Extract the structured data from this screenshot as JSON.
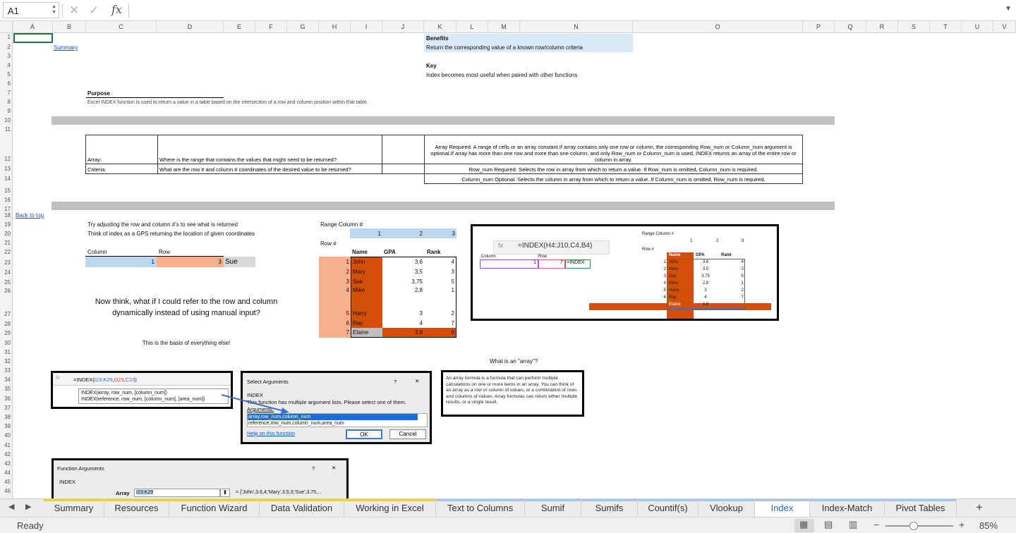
{
  "formula_bar": {
    "name_box": "A1",
    "fx": "fx"
  },
  "columns": [
    "A",
    "B",
    "C",
    "D",
    "E",
    "F",
    "G",
    "H",
    "I",
    "J",
    "K",
    "L",
    "M",
    "N",
    "O",
    "P",
    "Q",
    "R",
    "S",
    "T",
    "U",
    "V"
  ],
  "rows": [
    "1",
    "2",
    "3",
    "4",
    "5",
    "6",
    "7",
    "8",
    "9",
    "10",
    "11",
    "12",
    "13",
    "14",
    "15",
    "16",
    "17",
    "18",
    "19",
    "20",
    "21",
    "22",
    "23",
    "24",
    "25",
    "26",
    "27",
    "28",
    "29",
    "30",
    "31",
    "32",
    "33",
    "34",
    "35",
    "36",
    "37",
    "38",
    "39",
    "40",
    "41",
    "42",
    "43",
    "44",
    "45",
    "46"
  ],
  "sheet": {
    "summary_link": "Summary",
    "back_to_top": "Back to top",
    "benefits_label": "Benefits",
    "benefits_text": "Return the corresponding value of a known row/column criteria",
    "key_label": "Key",
    "key_text": "Index becomes most useful when paired with other functions",
    "purpose_label": "Purpose",
    "purpose_text": "Excel INDEX function is used to return a value in a table based on the intersection of a row and column position within that table.",
    "array_label": "Array:",
    "array_question": "Where is the range that contains the values that might need to be returned?",
    "criteria_label": "Criteria:",
    "criteria_question": "What are the row # and column # coordinates of the desired value to be returned?",
    "array_desc": "Array    Required. A range of cells or an array constant.If array contains only one row or column, the corresponding Row_num or Column_num argument is optional.If array has more than one row and more than one column, and only Row_num or Column_num is used, INDEX returns an array of the entire row or column in array.",
    "rownum_desc": "Row_num    Required. Selects the row in array from which to return a value. If Row_num is omitted, Column_num is required.",
    "colnum_desc": "Column_num    Optional. Selects the column in array from which to return a value. If Column_num is omitted, Row_num is required.",
    "try_text": "Try adjusting the row and column #'s to see what is returned",
    "gps_text": "Think of index as a GPS returning the location of given coordinates",
    "column_label": "Column",
    "row_label": "Row",
    "column_value": "1",
    "row_value": "3",
    "result_value": "Sue",
    "think_text_1": "Now think, what if I could refer to the row and column",
    "think_text_2": "dynamically instead of using manual input?",
    "basis_text": "This is the basis of everything else!",
    "range_column_label": "Range Column #",
    "row_num_label": "Row #",
    "range_cols": [
      "1",
      "2",
      "3"
    ],
    "headers": [
      "Name",
      "GPA",
      "Rank"
    ],
    "table_rows": [
      {
        "n": "1",
        "name": "John",
        "gpa": "3,6",
        "rank": "4"
      },
      {
        "n": "2",
        "name": "Mary",
        "gpa": "3,5",
        "rank": "3"
      },
      {
        "n": "3",
        "name": "Sue",
        "gpa": "3,75",
        "rank": "5"
      },
      {
        "n": "4",
        "name": "Mike",
        "gpa": "2,8",
        "rank": "1"
      },
      {
        "n": "5",
        "name": "Harry",
        "gpa": "3",
        "rank": "2"
      },
      {
        "n": "6",
        "name": "Ray",
        "gpa": "4",
        "rank": "7"
      },
      {
        "n": "7",
        "name": "Elaine",
        "gpa": "3,9",
        "rank": "6"
      }
    ],
    "array_question_title": "What is an \"array\"?",
    "array_explain": "An array formula is a formula that can perform multiple calculations on one or more items in an array. You can think of an array as a row or column of values, or a combination of rows and columns of values. Array formulas can return either multiple results, or a single result."
  },
  "screenshot1": {
    "formula": "=INDEX(H4:J10,C4,B4)",
    "range_label": "Range Column #",
    "row_label": "Row #",
    "cols": [
      "1",
      "2",
      "3"
    ],
    "column_label": "Column",
    "row_label2": "Row",
    "col_val": "1",
    "row_val": "7",
    "typed": "=INDEX",
    "headers": [
      "Name",
      "GPA",
      "Rank"
    ],
    "rows": [
      {
        "n": "1",
        "name": "John",
        "gpa": "3.6",
        "rank": "4"
      },
      {
        "n": "2",
        "name": "Mary",
        "gpa": "3.5",
        "rank": "3"
      },
      {
        "n": "3",
        "name": "Sue",
        "gpa": "3.75",
        "rank": "5"
      },
      {
        "n": "4",
        "name": "Mike",
        "gpa": "2.8",
        "rank": "1"
      },
      {
        "n": "5",
        "name": "Harry",
        "gpa": "3",
        "rank": "2"
      },
      {
        "n": "6",
        "name": "Ray",
        "gpa": "4",
        "rank": "7"
      },
      {
        "n": "",
        "name": "Elaine",
        "gpa": "3.9",
        "rank": ""
      }
    ]
  },
  "screenshot2": {
    "formula_prefix": "=INDEX(",
    "formula_range": "I23:K29",
    "formula_row": "D23",
    "formula_col": "C23",
    "hint1": "INDEX(array, row_num, [column_num])",
    "hint2": "INDEX(reference, row_num, [column_num], [area_num])"
  },
  "dialog_select": {
    "title": "Select Arguments",
    "help": "?",
    "close": "✕",
    "func": "INDEX",
    "desc": "This function has multiple argument lists.  Please select one of them.",
    "args_label": "Arguments:",
    "options": [
      "array,row_num,column_num",
      "reference,row_num,column_num,area_num"
    ],
    "help_link": "Help on this function",
    "ok": "OK",
    "cancel": "Cancel"
  },
  "dialog_func_args": {
    "title": "Function Arguments",
    "help": "?",
    "close": "✕",
    "func": "INDEX",
    "array_label": "Array",
    "array_value": "I23:K29",
    "array_result": "= {'John',3.6,4;'Mary',3.5,3;'Sue',3.75,..."
  },
  "tabs": [
    {
      "label": "Summary",
      "color": "#f2c75c"
    },
    {
      "label": "Resources",
      "color": "#f2c75c"
    },
    {
      "label": "Function Wizard",
      "color": "#f2c75c"
    },
    {
      "label": "Data Validation",
      "color": "#f2c75c"
    },
    {
      "label": "Working in Excel",
      "color": "#f2c75c"
    },
    {
      "label": "Text to Columns",
      "color": "#a9c4e8"
    },
    {
      "label": "Sumif",
      "color": "#a9c4e8"
    },
    {
      "label": "Sumifs",
      "color": "#a9c4e8"
    },
    {
      "label": "Countif(s)",
      "color": "#a9c4e8"
    },
    {
      "label": "Vlookup",
      "color": "#a9c4e8"
    },
    {
      "label": "Index",
      "color": "#a9c4e8"
    },
    {
      "label": "Index-Match",
      "color": "#a9c4e8"
    },
    {
      "label": "Pivot Tables",
      "color": "#a9c4e8"
    }
  ],
  "add_sheet": "+",
  "status": {
    "ready": "Ready",
    "zoom": "85%",
    "minus": "−",
    "plus": "+"
  },
  "colors": {
    "orange": "#d24f07",
    "light_orange": "#f8b08c",
    "light_blue": "#bdd7ee",
    "excel_green": "#217346"
  }
}
